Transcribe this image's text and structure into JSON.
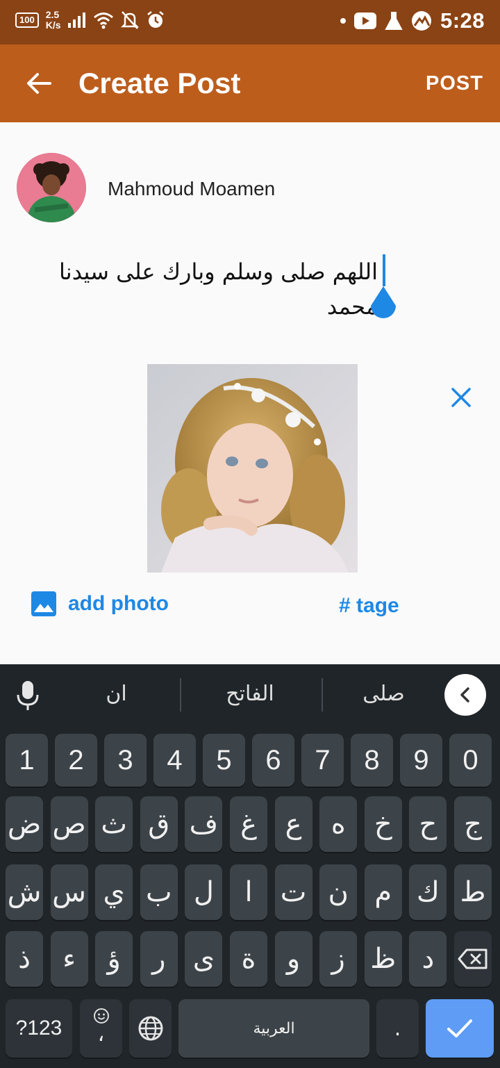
{
  "status_bar": {
    "battery": "100",
    "net_speed_value": "2.5",
    "net_speed_unit": "K/s",
    "time": "5:28"
  },
  "app_bar": {
    "title": "Create Post",
    "post_label": "POST"
  },
  "composer": {
    "username": "Mahmoud Moamen",
    "text": "اللهم صلى وسلم وبارك على سيدنا محمد",
    "add_photo_label": "add photo",
    "tag_label": "# tage"
  },
  "keyboard": {
    "suggestions": [
      "ان",
      "الفاتح",
      "صلى"
    ],
    "numbers_row": [
      "1",
      "2",
      "3",
      "4",
      "5",
      "6",
      "7",
      "8",
      "9",
      "0"
    ],
    "row1": [
      "ض",
      "ص",
      "ث",
      "ق",
      "ف",
      "غ",
      "ع",
      "ه",
      "خ",
      "ح",
      "ج"
    ],
    "row2": [
      "ش",
      "س",
      "ي",
      "ب",
      "ل",
      "ا",
      "ت",
      "ن",
      "م",
      "ك",
      "ط"
    ],
    "row3": [
      "ذ",
      "ء",
      "ؤ",
      "ر",
      "ى",
      "ة",
      "و",
      "ز",
      "ظ",
      "د"
    ],
    "symbols_label": "?123",
    "comma": "،",
    "space_label": "العربية",
    "period": "."
  },
  "colors": {
    "status_bar": "#8a4314",
    "app_bar": "#bd5d1c",
    "accent": "#1e88e5",
    "keyboard_bg": "#202529",
    "key_bg": "#3d4449",
    "enter_key": "#5e9cf5"
  }
}
